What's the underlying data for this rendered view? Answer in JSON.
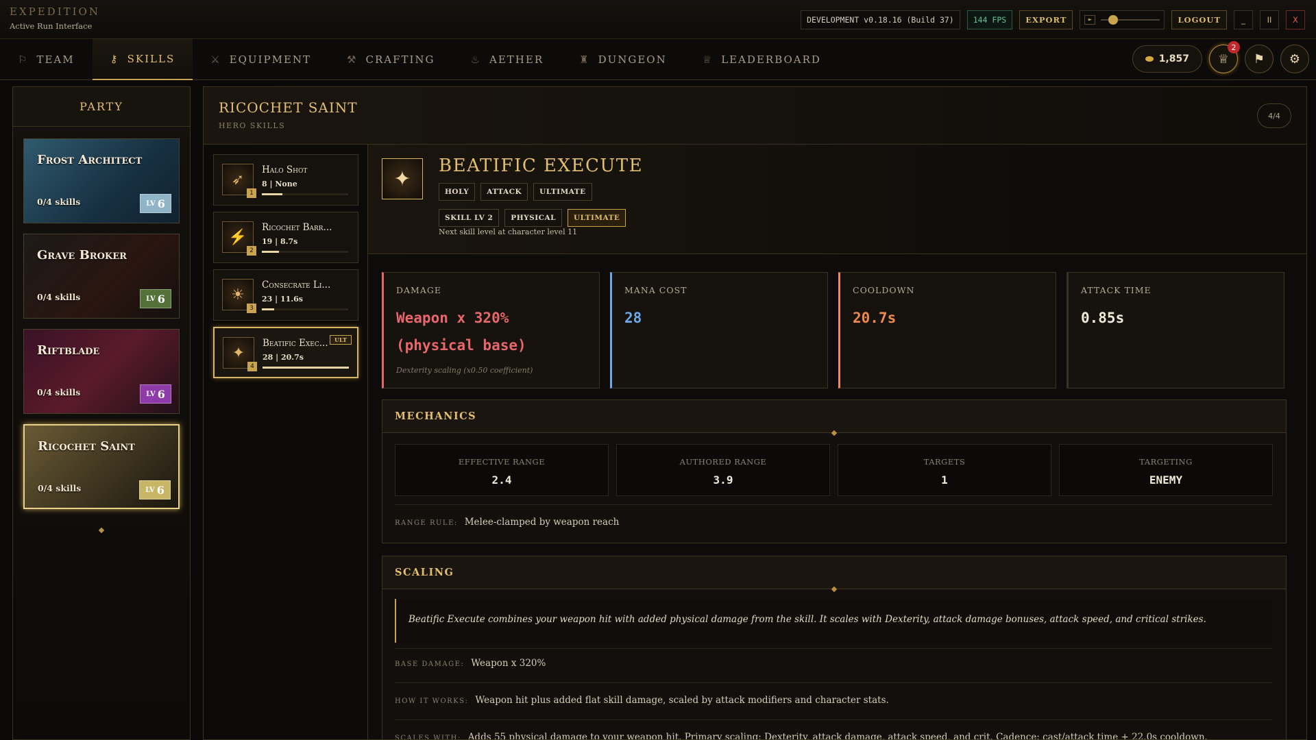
{
  "app": {
    "title": "EXPEDITION",
    "subtitle": "Active Run Interface"
  },
  "topbar": {
    "version": "DEVELOPMENT v0.18.16 (Build 37)",
    "fps": "144 FPS",
    "export_label": "EXPORT",
    "logout_label": "LOGOUT",
    "volume": 0.2,
    "minimize": "_",
    "pause": "II",
    "close": "X"
  },
  "nav": {
    "tabs": [
      {
        "label": "Team",
        "icon": "running-figure-icon",
        "active": false
      },
      {
        "label": "Skills",
        "icon": "key-icon",
        "active": true
      },
      {
        "label": "Equipment",
        "icon": "crossed-swords-icon",
        "active": false
      },
      {
        "label": "Crafting",
        "icon": "anvil-icon",
        "active": false
      },
      {
        "label": "Aether",
        "icon": "flame-icon",
        "active": false
      },
      {
        "label": "Dungeon",
        "icon": "castle-icon",
        "active": false
      },
      {
        "label": "Leaderboard",
        "icon": "trophy-icon",
        "active": false
      }
    ],
    "gold": "1,857",
    "notifications": "2"
  },
  "party": {
    "title": "Party",
    "heroes": [
      {
        "name": "Frost Architect",
        "skills": "0/4 skills",
        "level": "6",
        "lv": "LV",
        "color": "#8fb4c8"
      },
      {
        "name": "Grave Broker",
        "skills": "0/4 skills",
        "level": "6",
        "lv": "LV",
        "color": "#54713a"
      },
      {
        "name": "Riftblade",
        "skills": "0/4 skills",
        "level": "6",
        "lv": "LV",
        "color": "#8e3aa8"
      },
      {
        "name": "Ricochet Saint",
        "skills": "0/4 skills",
        "level": "6",
        "lv": "LV",
        "color": "#c8b566"
      }
    ]
  },
  "main": {
    "title": "Ricochet Saint",
    "subtitle": "Hero Skills",
    "count": "4/4",
    "skills": [
      {
        "name": "Halo Shot",
        "meta": "8 | None",
        "num": "1",
        "icon": "bow-icon",
        "progress": 0.24
      },
      {
        "name": "Ricochet Barr...",
        "meta": "19 | 8.7s",
        "num": "2",
        "icon": "lightning-icon",
        "progress": 0.2
      },
      {
        "name": "Consecrate Li...",
        "meta": "23 | 11.6s",
        "num": "3",
        "icon": "radiance-icon",
        "progress": 0.14
      },
      {
        "name": "Beatific Exec...",
        "meta": "28 | 20.7s",
        "num": "4",
        "icon": "winged-emblem-icon",
        "progress": 1.0,
        "tag": "ULT"
      }
    ],
    "detail": {
      "name": "Beatific Execute",
      "tags": [
        "Holy",
        "Attack",
        "Ultimate"
      ],
      "chips": [
        "Skill Lv 2",
        "Physical",
        "Ultimate"
      ],
      "next_level": "Next skill level at character level 11",
      "stats": [
        {
          "label": "Damage",
          "value": "Weapon x 320% (physical base)",
          "note": "Dexterity scaling (x0.50 coefficient)",
          "color": "#e8676a"
        },
        {
          "label": "Mana Cost",
          "value": "28",
          "note": "",
          "color": "#6fa8e8"
        },
        {
          "label": "Cooldown",
          "value": "20.7s",
          "note": "",
          "color": "#f08a4c"
        },
        {
          "label": "Attack Time",
          "value": "0.85s",
          "note": "",
          "color": "#f2ead8"
        }
      ],
      "mechanics": {
        "title": "Mechanics",
        "items": [
          {
            "label": "Effective Range",
            "value": "2.4"
          },
          {
            "label": "Authored Range",
            "value": "3.9"
          },
          {
            "label": "Targets",
            "value": "1"
          },
          {
            "label": "Targeting",
            "value": "ENEMY"
          }
        ],
        "range_rule_label": "Range Rule:",
        "range_rule": "Melee-clamped by weapon reach"
      },
      "scaling": {
        "title": "Scaling",
        "description": "Beatific Execute combines your weapon hit with added physical damage from the skill. It scales with Dexterity, attack damage bonuses, attack speed, and critical strikes.",
        "base_damage_label": "Base Damage:",
        "base_damage": "Weapon x 320%",
        "how_label": "How it works:",
        "how": "Weapon hit plus added flat skill damage, scaled by attack modifiers and character stats.",
        "scales_label": "Scales with:",
        "scales": "Adds 55 physical damage to your weapon hit. Primary scaling: Dexterity, attack damage, attack speed, and crit. Cadence: cast/attack time + 22.0s cooldown."
      }
    }
  }
}
